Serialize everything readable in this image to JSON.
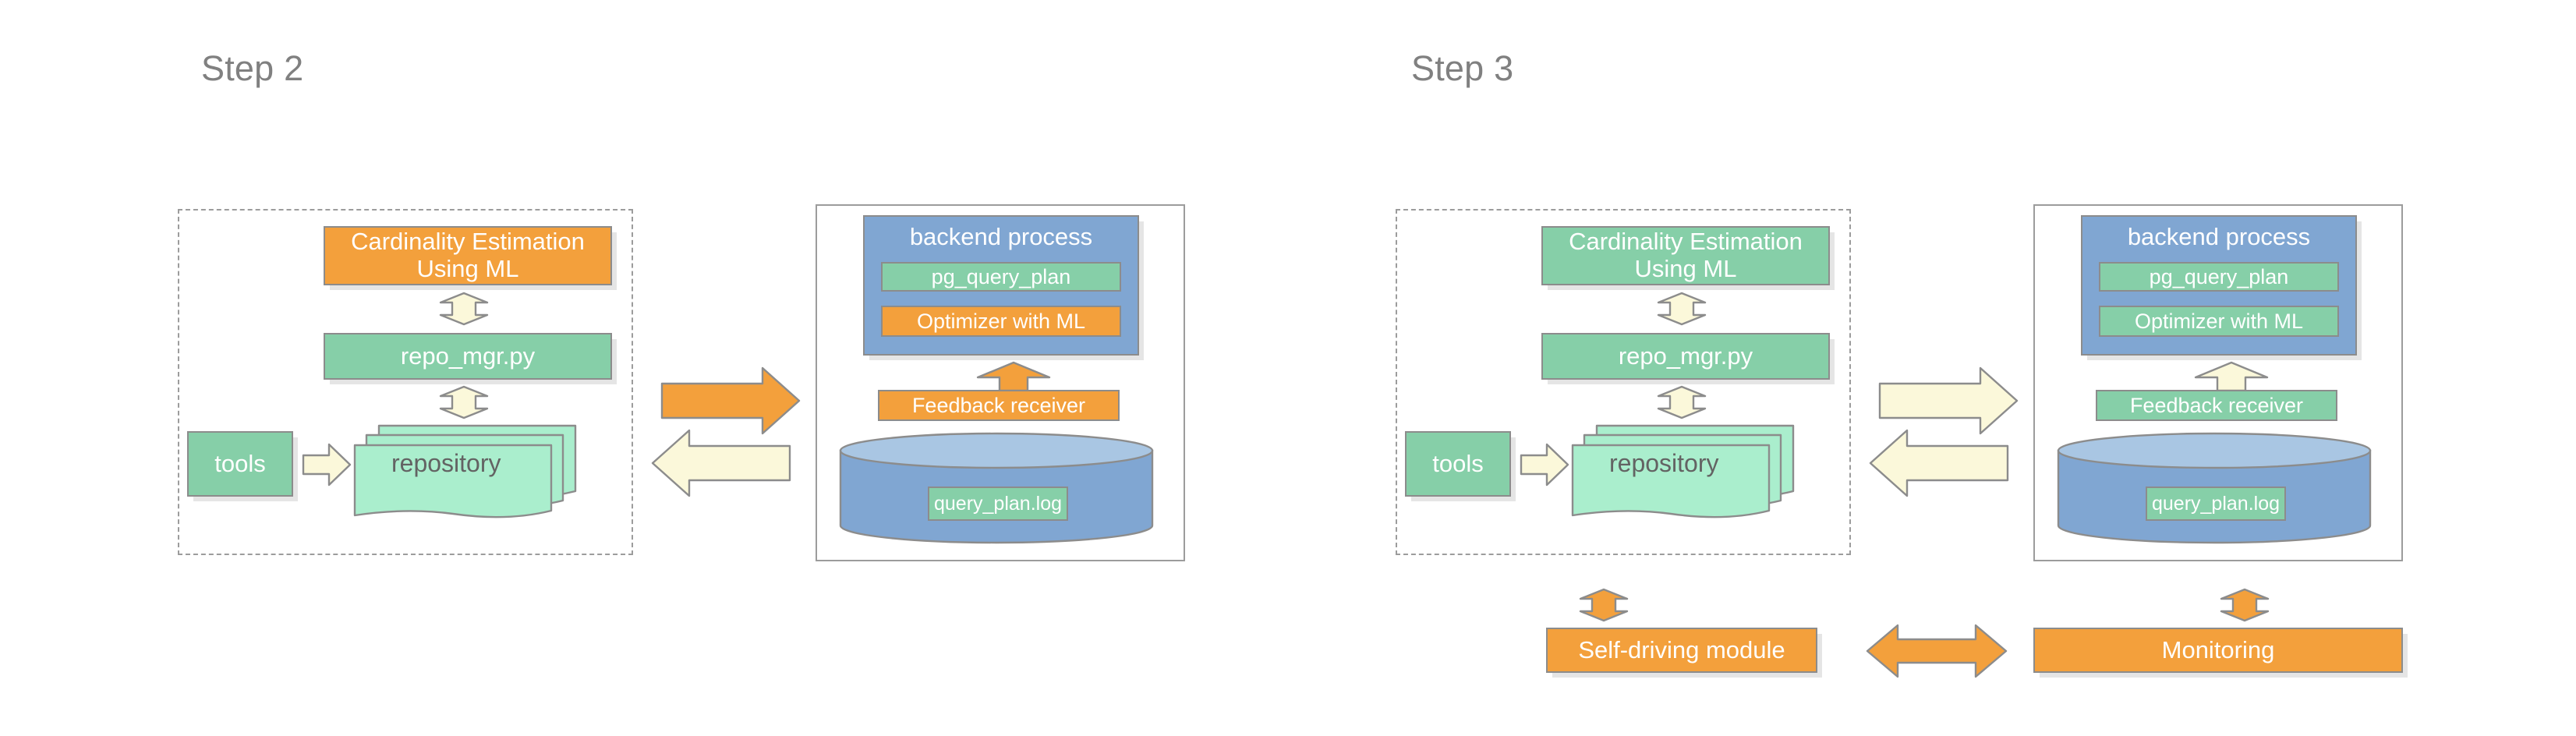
{
  "colors": {
    "orange": "#f3a03c",
    "green": "#86cfa8",
    "green_light": "#aaeecd",
    "blue": "#80a6d2",
    "blue_light": "#a9c6e3",
    "pale_yellow": "#fbf8da",
    "stroke": "#8c8c8c",
    "title_gray": "#808080",
    "panel_gray": "#9c9c9c",
    "label_gray": "#636363"
  },
  "steps": [
    {
      "title": "Step 2",
      "left_panel": {
        "type": "dashed",
        "nodes": [
          {
            "name": "cardinality-estimation",
            "label": "Cardinality Estimation\nUsing ML",
            "color": "orange"
          },
          {
            "name": "repo-mgr",
            "label": "repo_mgr.py",
            "color": "green"
          },
          {
            "name": "tools",
            "label": "tools",
            "color": "green"
          },
          {
            "name": "repository",
            "label": "repository",
            "color": "green_light"
          }
        ],
        "connectors": [
          {
            "name": "cardinality-to-repomgr",
            "direction": "vertical-bidirectional",
            "color": "pale_yellow"
          },
          {
            "name": "repomgr-to-repository",
            "direction": "vertical-bidirectional",
            "color": "pale_yellow"
          },
          {
            "name": "tools-to-repository",
            "direction": "right",
            "color": "pale_yellow"
          }
        ]
      },
      "right_panel": {
        "type": "solid",
        "process": {
          "name": "backend-process",
          "label": "backend process",
          "color": "blue",
          "children": [
            {
              "name": "pg-query-plan",
              "label": "pg_query_plan",
              "color": "green"
            },
            {
              "name": "optimizer-with-ml",
              "label": "Optimizer with ML",
              "color": "orange"
            }
          ]
        },
        "feedback_receiver": {
          "name": "feedback-receiver",
          "label": "Feedback receiver",
          "color": "orange"
        },
        "database": {
          "name": "log-database",
          "label": "query_plan.log",
          "color": "blue",
          "inner_color": "green"
        },
        "connectors": [
          {
            "name": "feedback-to-backend",
            "direction": "up",
            "color": "orange"
          }
        ]
      },
      "middle_arrows": [
        {
          "name": "left-to-right-arrow",
          "direction": "right",
          "color": "orange"
        },
        {
          "name": "right-to-left-arrow",
          "direction": "left",
          "color": "pale_yellow"
        }
      ]
    },
    {
      "title": "Step 3",
      "left_panel": {
        "type": "dashed",
        "nodes": [
          {
            "name": "cardinality-estimation",
            "label": "Cardinality Estimation\nUsing ML",
            "color": "green"
          },
          {
            "name": "repo-mgr",
            "label": "repo_mgr.py",
            "color": "green"
          },
          {
            "name": "tools",
            "label": "tools",
            "color": "green"
          },
          {
            "name": "repository",
            "label": "repository",
            "color": "green_light"
          }
        ],
        "connectors": [
          {
            "name": "cardinality-to-repomgr",
            "direction": "vertical-bidirectional",
            "color": "pale_yellow"
          },
          {
            "name": "repomgr-to-repository",
            "direction": "vertical-bidirectional",
            "color": "pale_yellow"
          },
          {
            "name": "tools-to-repository",
            "direction": "right",
            "color": "pale_yellow"
          }
        ]
      },
      "right_panel": {
        "type": "solid",
        "process": {
          "name": "backend-process",
          "label": "backend process",
          "color": "blue",
          "children": [
            {
              "name": "pg-query-plan",
              "label": "pg_query_plan",
              "color": "green"
            },
            {
              "name": "optimizer-with-ml",
              "label": "Optimizer with ML",
              "color": "green"
            }
          ]
        },
        "feedback_receiver": {
          "name": "feedback-receiver",
          "label": "Feedback receiver",
          "color": "green"
        },
        "database": {
          "name": "log-database",
          "label": "query_plan.log",
          "color": "blue",
          "inner_color": "green"
        },
        "connectors": [
          {
            "name": "feedback-to-backend",
            "direction": "up",
            "color": "pale_yellow"
          }
        ]
      },
      "middle_arrows": [
        {
          "name": "left-to-right-arrow",
          "direction": "right",
          "color": "pale_yellow"
        },
        {
          "name": "right-to-left-arrow",
          "direction": "left",
          "color": "pale_yellow"
        }
      ],
      "bottom": {
        "self_driving": {
          "name": "self-driving-module",
          "label": "Self-driving module",
          "color": "orange"
        },
        "monitoring": {
          "name": "monitoring",
          "label": "Monitoring",
          "color": "orange"
        },
        "connectors": [
          {
            "name": "selfdriving-to-panel",
            "direction": "vertical-bidirectional",
            "color": "orange"
          },
          {
            "name": "monitoring-to-panel",
            "direction": "vertical-bidirectional",
            "color": "orange"
          },
          {
            "name": "selfdriving-to-monitoring",
            "direction": "horizontal-bidirectional",
            "color": "orange"
          }
        ]
      }
    }
  ]
}
